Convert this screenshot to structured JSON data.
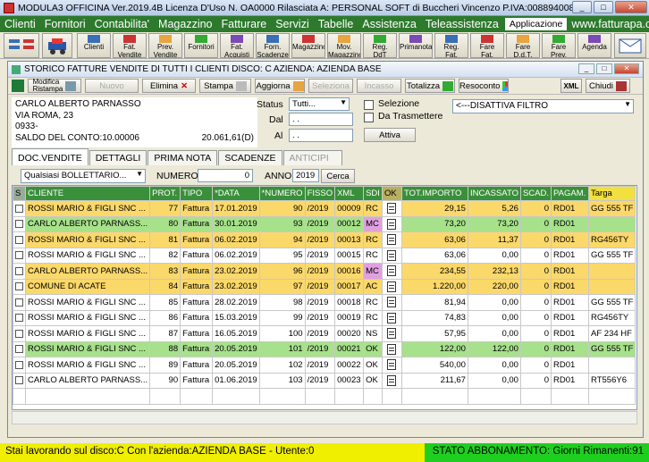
{
  "app": {
    "title": "MODULA3 OFFICINA Ver.2019.4B  Licenza D'Uso N. OA0000  Rilasciata A: PERSONAL SOFT di Buccheri Vincenzo P.IVA:00889400883"
  },
  "menu": [
    "Clienti",
    "Fornitori",
    "Contabilita'",
    "Magazzino",
    "Fatturare",
    "Servizi",
    "Tabelle",
    "Assistenza",
    "Teleassistenza",
    "Applicazione",
    "www.fatturapa.com"
  ],
  "toolbar": [
    {
      "label": "Clienti",
      "icon": "clients-icon"
    },
    {
      "label": "Fat.\nVendite",
      "icon": "sales-invoice-icon"
    },
    {
      "label": "Prev.\nVendite",
      "icon": "quote-icon"
    },
    {
      "label": "Fornitori",
      "icon": "suppliers-icon"
    },
    {
      "label": "Fat.\nAcquisti",
      "icon": "purchase-invoice-icon"
    },
    {
      "label": "Forn.\nScadenze",
      "icon": "due-dates-icon"
    },
    {
      "label": "Magazzino",
      "icon": "warehouse-icon"
    },
    {
      "label": "Mov.\nMagazzino",
      "icon": "stock-movement-icon"
    },
    {
      "label": "Reg.\nDdT\nAcquisto",
      "icon": "ddt-purchase-icon"
    },
    {
      "label": "Primanota",
      "icon": "primanota-icon"
    },
    {
      "label": "Reg.\nFat.\nAcquisto",
      "icon": "register-purchase-icon"
    },
    {
      "label": "Fare\nFat.\nImmediata",
      "icon": "immediate-invoice-icon"
    },
    {
      "label": "Fare\nD.d.T.",
      "icon": "make-ddt-icon"
    },
    {
      "label": "Fare\nPrev.\nVendita",
      "icon": "make-quote-icon"
    },
    {
      "label": "Agenda",
      "icon": "agenda-icon"
    }
  ],
  "window": {
    "title": "STORICO FATTURE VENDITE DI TUTTI I CLIENTI   DISCO: C   AZIENDA: AZIENDA BASE"
  },
  "actions": {
    "modifica": "Modifica\nRistampa",
    "nuovo": "Nuovo",
    "elimina": "Elimina",
    "stampa": "Stampa",
    "aggiorna": "Aggiorna",
    "seleziona": "Seleziona",
    "incasso": "Incasso",
    "totalizza": "Totalizza",
    "resoconto": "Resoconto",
    "chiudi": "Chiudi",
    "xml": "XML"
  },
  "client": {
    "name": "CARLO ALBERTO PARNASSO",
    "address": "VIA ROMA, 23",
    "code": "0933-",
    "saldo_label": "SALDO DEL CONTO:10.00006",
    "saldo_value": "20.061,61(D)"
  },
  "filters": {
    "status_label": "Status",
    "status_value": "Tutti...",
    "dal_label": "Dal",
    "dal_value": "  .  .",
    "al_label": "Al",
    "al_value": "  .  .",
    "selezione_label": "Selezione",
    "trasmettere_label": "Da Trasmettere",
    "attiva": "Attiva",
    "filtro": "<---DISATTIVA FILTRO"
  },
  "tabs": [
    "DOC.VENDITE",
    "DETTAGLI",
    "PRIMA NOTA",
    "SCADENZE",
    "ANTICIPI"
  ],
  "search": {
    "type_value": "Qualsiasi BOLLETTARIO...",
    "numero_label": "NUMERO",
    "numero_value": "0",
    "anno_label": "ANNO",
    "anno_value": "2019",
    "cerca": "Cerca"
  },
  "table": {
    "headers": [
      "S",
      "CLIENTE",
      "PROT.",
      "TIPO",
      "*DATA",
      "*NUMERO",
      "FISSO",
      "XML",
      "SDI",
      "OK",
      "TOT.IMPORTO",
      "INCASSATO",
      "SCAD.",
      "PAGAM.",
      "Targa"
    ],
    "rows": [
      {
        "color": "yellow",
        "cliente": "ROSSI MARIO & FIGLI SNC ...",
        "prot": "77",
        "tipo": "Fattura",
        "data": "17.01.2019",
        "numero": "90",
        "fisso": "/2019",
        "xml": "00009",
        "sdi": "RC",
        "tot": "29,15",
        "inc": "5,26",
        "scad": "0",
        "pag": "RD01",
        "targa": "GG 555 TF"
      },
      {
        "color": "green",
        "cliente": "CARLO ALBERTO PARNASS...",
        "prot": "80",
        "tipo": "Fattura",
        "data": "30.01.2019",
        "numero": "93",
        "fisso": "/2019",
        "xml": "00012",
        "sdi": "MC",
        "tot": "73,20",
        "inc": "73,20",
        "scad": "0",
        "pag": "RD01",
        "targa": ""
      },
      {
        "color": "yellow",
        "cliente": "ROSSI MARIO & FIGLI SNC ...",
        "prot": "81",
        "tipo": "Fattura",
        "data": "06.02.2019",
        "numero": "94",
        "fisso": "/2019",
        "xml": "00013",
        "sdi": "RC",
        "tot": "63,06",
        "inc": "11,37",
        "scad": "0",
        "pag": "RD01",
        "targa": "RG456TY"
      },
      {
        "color": "white",
        "cliente": "ROSSI MARIO & FIGLI SNC ...",
        "prot": "82",
        "tipo": "Fattura",
        "data": "06.02.2019",
        "numero": "95",
        "fisso": "/2019",
        "xml": "00015",
        "sdi": "RC",
        "tot": "63,06",
        "inc": "0,00",
        "scad": "0",
        "pag": "RD01",
        "targa": "GG 555 TF"
      },
      {
        "color": "yellow",
        "cliente": "CARLO ALBERTO PARNASS...",
        "prot": "83",
        "tipo": "Fattura",
        "data": "23.02.2019",
        "numero": "96",
        "fisso": "/2019",
        "xml": "00016",
        "sdi": "MC",
        "tot": "234,55",
        "inc": "232,13",
        "scad": "0",
        "pag": "RD01",
        "targa": ""
      },
      {
        "color": "yellow",
        "cliente": "COMUNE DI ACATE",
        "prot": "84",
        "tipo": "Fattura",
        "data": "23.02.2019",
        "numero": "97",
        "fisso": "/2019",
        "xml": "00017",
        "sdi": "AC",
        "tot": "1.220,00",
        "inc": "220,00",
        "scad": "0",
        "pag": "RD01",
        "targa": ""
      },
      {
        "color": "white",
        "cliente": "ROSSI MARIO & FIGLI SNC ...",
        "prot": "85",
        "tipo": "Fattura",
        "data": "28.02.2019",
        "numero": "98",
        "fisso": "/2019",
        "xml": "00018",
        "sdi": "RC",
        "tot": "81,94",
        "inc": "0,00",
        "scad": "0",
        "pag": "RD01",
        "targa": "GG 555 TF"
      },
      {
        "color": "white",
        "cliente": "ROSSI MARIO & FIGLI SNC ...",
        "prot": "86",
        "tipo": "Fattura",
        "data": "15.03.2019",
        "numero": "99",
        "fisso": "/2019",
        "xml": "00019",
        "sdi": "RC",
        "tot": "74,83",
        "inc": "0,00",
        "scad": "0",
        "pag": "RD01",
        "targa": "RG456TY"
      },
      {
        "color": "white",
        "cliente": "ROSSI MARIO & FIGLI SNC ...",
        "prot": "87",
        "tipo": "Fattura",
        "data": "16.05.2019",
        "numero": "100",
        "fisso": "/2019",
        "xml": "00020",
        "sdi": "NS",
        "tot": "57,95",
        "inc": "0,00",
        "scad": "0",
        "pag": "RD01",
        "targa": "AF 234 HF"
      },
      {
        "color": "green",
        "cliente": "ROSSI MARIO & FIGLI SNC ...",
        "prot": "88",
        "tipo": "Fattura",
        "data": "20.05.2019",
        "numero": "101",
        "fisso": "/2019",
        "xml": "00021",
        "sdi": "OK",
        "tot": "122,00",
        "inc": "122,00",
        "scad": "0",
        "pag": "RD01",
        "targa": "GG 555 TF"
      },
      {
        "color": "white",
        "cliente": "ROSSI MARIO & FIGLI SNC ...",
        "prot": "89",
        "tipo": "Fattura",
        "data": "20.05.2019",
        "numero": "102",
        "fisso": "/2019",
        "xml": "00022",
        "sdi": "OK",
        "tot": "540,00",
        "inc": "0,00",
        "scad": "0",
        "pag": "RD01",
        "targa": ""
      },
      {
        "color": "white",
        "cliente": "CARLO ALBERTO PARNASS...",
        "prot": "90",
        "tipo": "Fattura",
        "data": "01.06.2019",
        "numero": "103",
        "fisso": "/2019",
        "xml": "00023",
        "sdi": "OK",
        "tot": "211,67",
        "inc": "0,00",
        "scad": "0",
        "pag": "RD01",
        "targa": "RT556Y6"
      }
    ]
  },
  "status": {
    "left": "Stai lavorando sul disco:C  Con l'azienda:AZIENDA BASE  - Utente:0",
    "right": "STATO ABBONAMENTO: Giorni Rimanenti:91"
  },
  "colors": {
    "menu": "#2d7a2d",
    "row_yellow": "#fbd86a",
    "row_green": "#a7e18b",
    "status_left": "#f0ef00",
    "status_right": "#1fcf1f"
  }
}
